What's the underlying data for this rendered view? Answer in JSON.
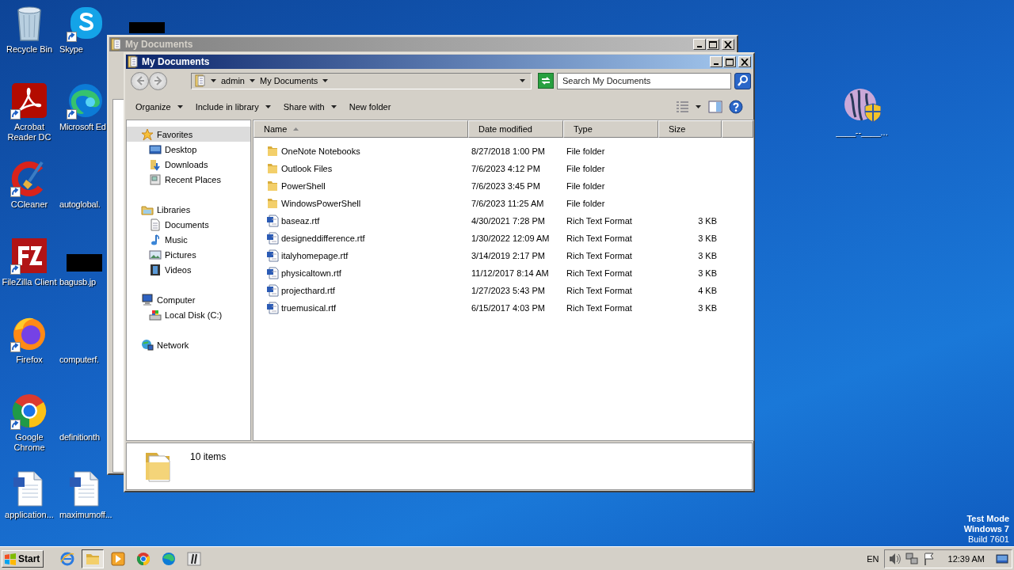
{
  "desktop": {
    "icons": [
      {
        "label": "Recycle Bin",
        "kind": "recycle",
        "shortcut": false
      },
      {
        "label": "Skype",
        "kind": "skype",
        "shortcut": true
      },
      {
        "label": "Acrobat Reader DC",
        "kind": "acrobat",
        "shortcut": true
      },
      {
        "label": "Microsoft Ed",
        "kind": "edge",
        "shortcut": true
      },
      {
        "label": "CCleaner",
        "kind": "ccleaner",
        "shortcut": true
      },
      {
        "label": "autoglobal.",
        "kind": "blank",
        "shortcut": false
      },
      {
        "label": "FileZilla Client",
        "kind": "filezilla",
        "shortcut": true
      },
      {
        "label": "bagusb.jp",
        "kind": "redacted",
        "shortcut": false
      },
      {
        "label": "Firefox",
        "kind": "firefox",
        "shortcut": true
      },
      {
        "label": "computerf.",
        "kind": "blank",
        "shortcut": false
      },
      {
        "label": "Google Chrome",
        "kind": "chrome",
        "shortcut": true
      },
      {
        "label": "definitionth",
        "kind": "blank",
        "shortcut": false
      },
      {
        "label": "application...",
        "kind": "word",
        "shortcut": false
      },
      {
        "label": "maximumoff...",
        "kind": "word",
        "shortcut": false
      }
    ],
    "side_icon": {
      "label": "____--____...",
      "kind": "shield-app"
    },
    "system_notice": [
      {
        "text": "Test Mode",
        "bold": true
      },
      {
        "text": "Windows 7",
        "bold": true
      },
      {
        "text": "Build 7601",
        "bold": false
      }
    ]
  },
  "back_window": {
    "title": "My Documents"
  },
  "window": {
    "title": "My Documents",
    "breadcrumb": [
      "admin",
      "My Documents"
    ],
    "search": {
      "placeholder": "Search My Documents"
    },
    "toolbar": [
      {
        "label": "Organize",
        "dropdown": true
      },
      {
        "label": "Include in library",
        "dropdown": true
      },
      {
        "label": "Share with",
        "dropdown": true
      },
      {
        "label": "New folder",
        "dropdown": false
      }
    ],
    "navigation": [
      {
        "label": "Favorites",
        "kind": "star",
        "selected": true,
        "children": [
          {
            "label": "Desktop",
            "kind": "desktop",
            "selected": false
          },
          {
            "label": "Downloads",
            "kind": "downloads",
            "selected": false
          },
          {
            "label": "Recent Places",
            "kind": "recent",
            "selected": false
          }
        ]
      },
      {
        "label": "Libraries",
        "kind": "libraries",
        "selected": false,
        "children": [
          {
            "label": "Documents",
            "kind": "documents",
            "selected": false
          },
          {
            "label": "Music",
            "kind": "music",
            "selected": false
          },
          {
            "label": "Pictures",
            "kind": "pictures",
            "selected": false
          },
          {
            "label": "Videos",
            "kind": "videos",
            "selected": false
          }
        ]
      },
      {
        "label": "Computer",
        "kind": "computer",
        "selected": false,
        "children": [
          {
            "label": "Local Disk (C:)",
            "kind": "disk",
            "selected": false
          }
        ]
      },
      {
        "label": "Network",
        "kind": "network",
        "selected": false
      }
    ],
    "columns": [
      {
        "label": "Name",
        "sorted": true
      },
      {
        "label": "Date modified",
        "sorted": false
      },
      {
        "label": "Type",
        "sorted": false
      },
      {
        "label": "Size",
        "sorted": false
      }
    ],
    "rows": [
      {
        "kind": "folder",
        "name": "OneNote Notebooks",
        "date": "8/27/2018 1:00 PM",
        "type": "File folder"
      },
      {
        "kind": "folder",
        "name": "Outlook Files",
        "date": "7/6/2023 4:12 PM",
        "type": "File folder"
      },
      {
        "kind": "folder",
        "name": "PowerShell",
        "date": "7/6/2023 3:45 PM",
        "type": "File folder"
      },
      {
        "kind": "folder",
        "name": "WindowsPowerShell",
        "date": "7/6/2023 11:25 AM",
        "type": "File folder"
      },
      {
        "kind": "rtf",
        "name": "baseaz.rtf",
        "date": "4/30/2021 7:28 PM",
        "type": "Rich Text Format",
        "size": "3 KB"
      },
      {
        "kind": "rtf",
        "name": "designeddifference.rtf",
        "date": "1/30/2022 12:09 AM",
        "type": "Rich Text Format",
        "size": "3 KB"
      },
      {
        "kind": "rtf",
        "name": "italyhomepage.rtf",
        "date": "3/14/2019 2:17 PM",
        "type": "Rich Text Format",
        "size": "3 KB"
      },
      {
        "kind": "rtf",
        "name": "physicaltown.rtf",
        "date": "11/12/2017 8:14 AM",
        "type": "Rich Text Format",
        "size": "3 KB"
      },
      {
        "kind": "rtf",
        "name": "projecthard.rtf",
        "date": "1/27/2023 5:43 PM",
        "type": "Rich Text Format",
        "size": "4 KB"
      },
      {
        "kind": "rtf",
        "name": "truemusical.rtf",
        "date": "6/15/2017 4:03 PM",
        "type": "Rich Text Format",
        "size": "3 KB"
      }
    ],
    "status": "10 items"
  },
  "taskbar": {
    "start": "Start",
    "apps": [
      {
        "kind": "ie",
        "active": false
      },
      {
        "kind": "explorer",
        "active": true
      },
      {
        "kind": "media",
        "active": false
      },
      {
        "kind": "chrome",
        "active": false
      },
      {
        "kind": "edge",
        "active": false
      },
      {
        "kind": "app",
        "active": false
      }
    ],
    "language": "EN",
    "clock": "12:39 AM"
  }
}
